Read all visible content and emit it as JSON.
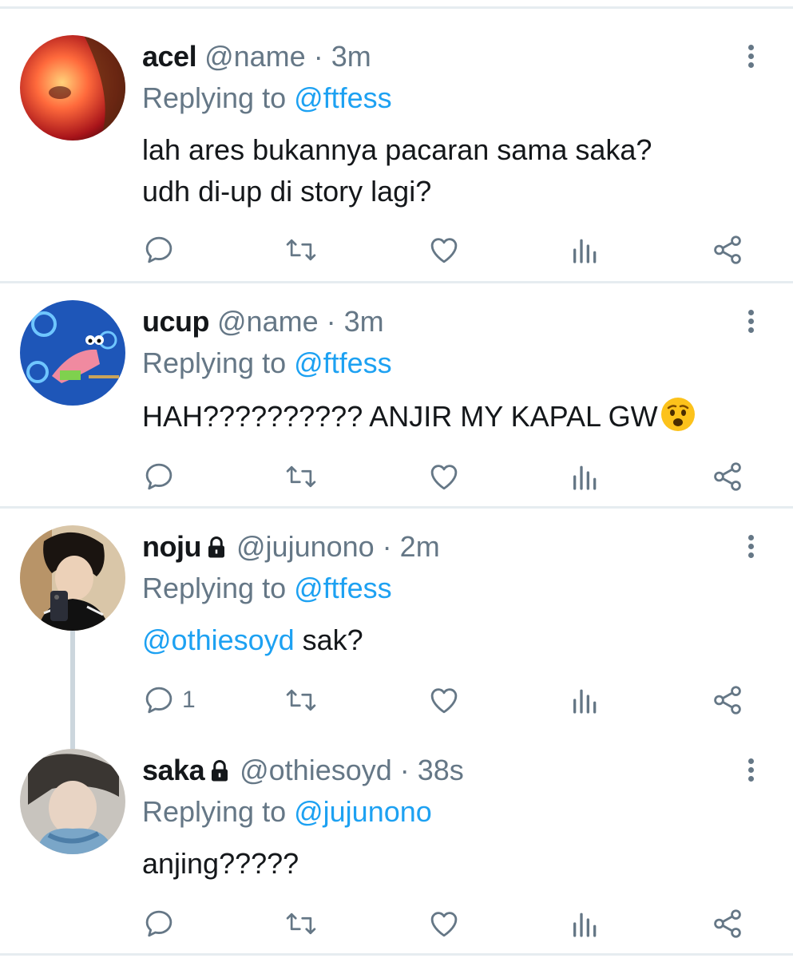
{
  "tweets": [
    {
      "name": "acel",
      "handle": "@name",
      "sep": " · ",
      "time": "3m",
      "replying_prefix": "Replying to ",
      "replying_to": "@ftfess",
      "text_line1": "lah ares bukannya pacaran sama saka?",
      "text_line2": "udh di-up di story lagi?",
      "locked": false,
      "reply_count": ""
    },
    {
      "name": "ucup",
      "handle": "@name",
      "sep": " · ",
      "time": "3m",
      "replying_prefix": "Replying to ",
      "replying_to": "@ftfess",
      "text_line1": "HAH?????????? ANJIR MY KAPAL GW",
      "emoji": "anxious-face-emoji",
      "locked": false,
      "reply_count": ""
    },
    {
      "name": "noju",
      "handle": "@jujunono",
      "sep": " · ",
      "time": "2m",
      "replying_prefix": "Replying to ",
      "replying_to": "@ftfess",
      "mention": "@othiesoyd",
      "text_rest": " sak?",
      "locked": true,
      "reply_count": "1"
    },
    {
      "name": "saka",
      "handle": "@othiesoyd",
      "sep": " · ",
      "time": "38s",
      "replying_prefix": "Replying to ",
      "replying_to": "@jujunono",
      "text_line1": "anjing?????",
      "locked": true,
      "reply_count": ""
    }
  ],
  "icons": {
    "reply": "reply-icon",
    "retweet": "retweet-icon",
    "like": "heart-icon",
    "analytics": "analytics-icon",
    "share": "share-icon",
    "more": "more-vertical-icon",
    "lock": "lock-icon"
  },
  "colors": {
    "link": "#1da1f2",
    "muted": "#657786",
    "divider": "#e6ecf0",
    "thread_line": "#ccd6dd"
  }
}
